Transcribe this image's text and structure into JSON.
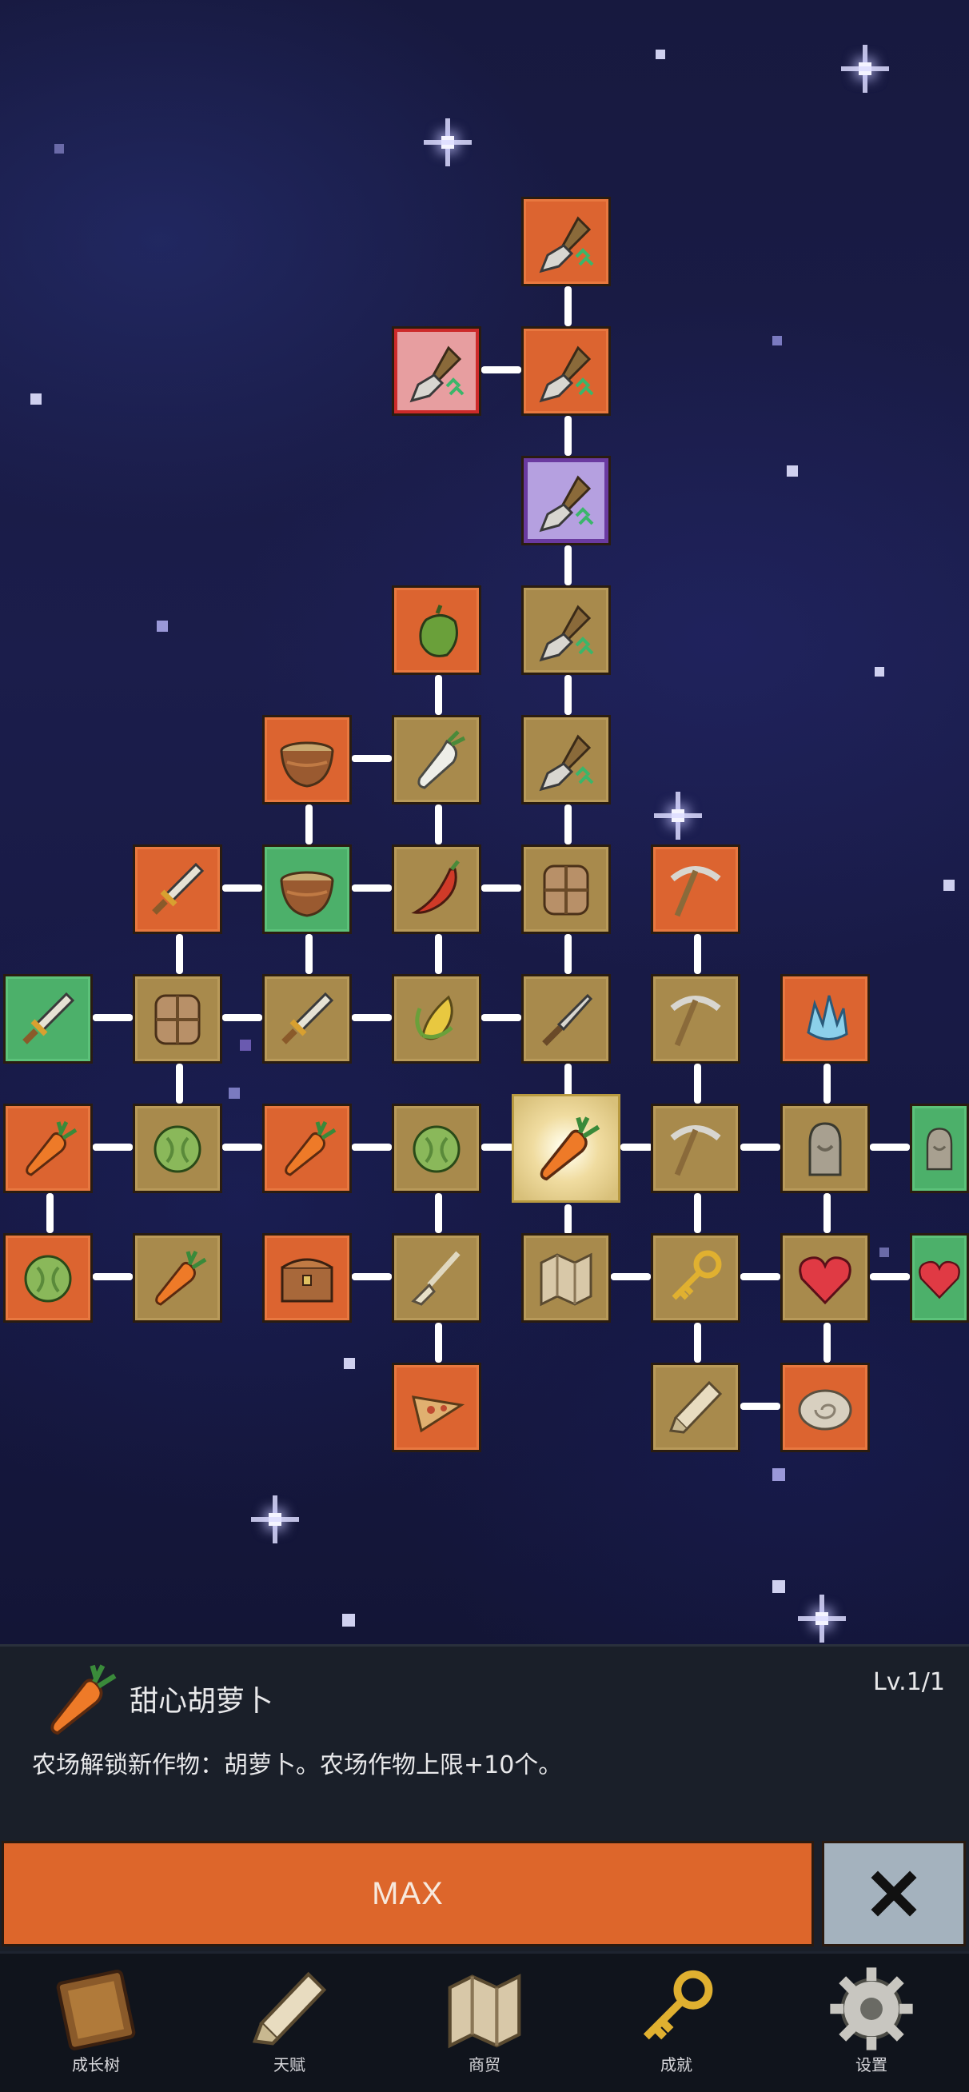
{
  "detail_panel": {
    "skill_name": "甜心胡萝卜",
    "level": "Lv.1/1",
    "description": "农场解锁新作物：胡萝卜。农场作物上限+10个。",
    "max_button_label": "MAX",
    "close_icon": "close-x-icon"
  },
  "bottom_nav": {
    "items": [
      {
        "label": "成长树",
        "icon": "book-icon"
      },
      {
        "label": "天赋",
        "icon": "scroll-icon"
      },
      {
        "label": "商贸",
        "icon": "map-icon"
      },
      {
        "label": "成就",
        "icon": "key-icon"
      },
      {
        "label": "设置",
        "icon": "gear-icon"
      }
    ]
  },
  "skill_tree": {
    "selected_node": "carrot",
    "nodes": [
      {
        "icon": "shovel-icon",
        "tier": "orange"
      },
      {
        "icon": "shovel-icon",
        "tier": "pink"
      },
      {
        "icon": "shovel-icon",
        "tier": "orange"
      },
      {
        "icon": "shovel-icon",
        "tier": "purple"
      },
      {
        "icon": "pepper-icon",
        "tier": "orange"
      },
      {
        "icon": "shovel-icon",
        "tier": "gold"
      },
      {
        "icon": "pot-icon",
        "tier": "orange"
      },
      {
        "icon": "radish-icon",
        "tier": "gold"
      },
      {
        "icon": "shovel-icon",
        "tier": "gold"
      },
      {
        "icon": "sword-icon",
        "tier": "orange"
      },
      {
        "icon": "pot-icon",
        "tier": "green"
      },
      {
        "icon": "chili-icon",
        "tier": "gold"
      },
      {
        "icon": "backpack-icon",
        "tier": "gold"
      },
      {
        "icon": "pickaxe-icon",
        "tier": "orange"
      },
      {
        "icon": "sword-icon",
        "tier": "green"
      },
      {
        "icon": "backpack-icon",
        "tier": "gold"
      },
      {
        "icon": "sword-icon",
        "tier": "gold"
      },
      {
        "icon": "corn-icon",
        "tier": "gold"
      },
      {
        "icon": "knife-icon",
        "tier": "gold"
      },
      {
        "icon": "pickaxe-icon",
        "tier": "gold"
      },
      {
        "icon": "crystal-icon",
        "tier": "orange"
      },
      {
        "icon": "carrot-icon",
        "tier": "orange"
      },
      {
        "icon": "cabbage-icon",
        "tier": "gold"
      },
      {
        "icon": "carrot-icon",
        "tier": "orange"
      },
      {
        "icon": "cabbage-icon",
        "tier": "gold"
      },
      {
        "icon": "carrot-icon",
        "tier": "selected"
      },
      {
        "icon": "pickaxe-icon",
        "tier": "gold"
      },
      {
        "icon": "statue-icon",
        "tier": "gold"
      },
      {
        "icon": "statue-icon",
        "tier": "green"
      },
      {
        "icon": "cabbage-icon",
        "tier": "orange"
      },
      {
        "icon": "carrot-icon",
        "tier": "gold"
      },
      {
        "icon": "chest-icon",
        "tier": "orange"
      },
      {
        "icon": "broom-icon",
        "tier": "gold"
      },
      {
        "icon": "map-icon",
        "tier": "gold"
      },
      {
        "icon": "key-icon",
        "tier": "gold"
      },
      {
        "icon": "heart-icon",
        "tier": "gold"
      },
      {
        "icon": "heart-icon",
        "tier": "green"
      },
      {
        "icon": "pizza-icon",
        "tier": "orange"
      },
      {
        "icon": "scroll-icon",
        "tier": "gold"
      },
      {
        "icon": "fossil-icon",
        "tier": "orange"
      }
    ]
  },
  "colors": {
    "tier_gold": "#a88a4c",
    "tier_orange": "#dc6430",
    "tier_green": "#4cb06a",
    "tier_purple": "#b5a0e0",
    "max_button": "#dd662b",
    "close_button": "#a4b2be"
  }
}
